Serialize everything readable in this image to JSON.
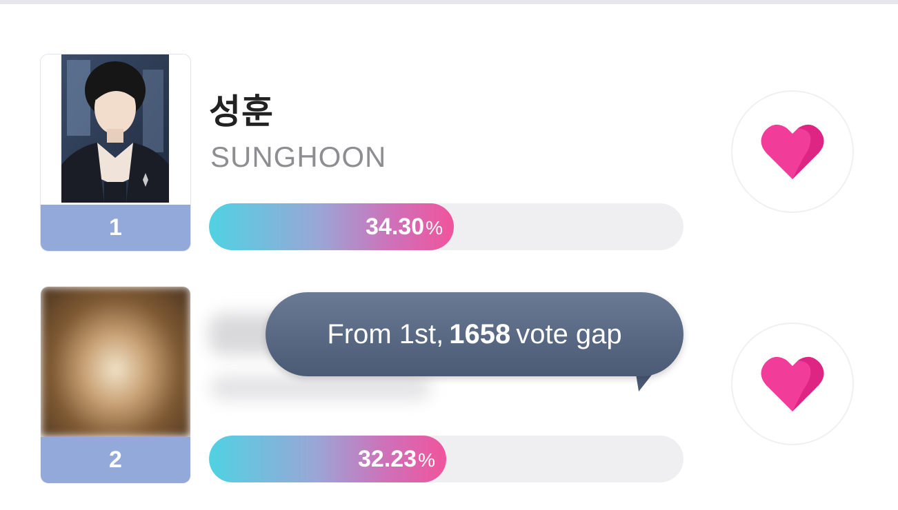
{
  "ranking": [
    {
      "rank": "1",
      "name_kr": "성훈",
      "name_en": "SUNGHOON",
      "percent_value": "34.30",
      "percent_sign": "%",
      "fill_fraction": 0.515,
      "photo": "member-photo",
      "vote_icon": "heart-icon"
    },
    {
      "rank": "2",
      "name_kr": "",
      "name_en": "",
      "percent_value": "32.23",
      "percent_sign": "%",
      "fill_fraction": 0.5,
      "photo": "blurred-photo",
      "vote_icon": "heart-icon"
    }
  ],
  "tooltip": {
    "prefix": "From 1st,",
    "gap": "1658",
    "suffix": "vote gap"
  },
  "colors": {
    "rank_badge": "#93a9d9",
    "heart": "#f23c9a",
    "tooltip_bg": "#55647e",
    "progress_start": "#4fd2e3",
    "progress_end": "#f0549c"
  }
}
